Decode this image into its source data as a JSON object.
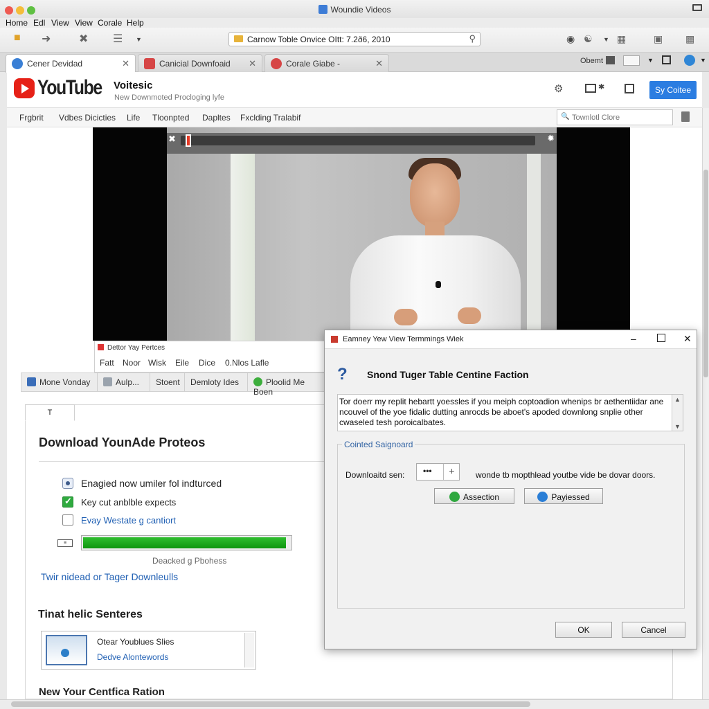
{
  "window": {
    "title": "Woundie Videos"
  },
  "menu": [
    "Home",
    "Edl",
    "View",
    "View",
    "Corale",
    "Help"
  ],
  "address": {
    "value": "Carnow Toble Onvice OItt: 7.2ð6, 2010"
  },
  "tabs": [
    {
      "label": "Cener Devidad",
      "color": "#3a7fd5"
    },
    {
      "label": "Canicial Downfoaid",
      "color": "#d64545"
    },
    {
      "label": "Corale Giabe -",
      "color": "#d64545"
    }
  ],
  "toolbar_right": {
    "label": "Obemt"
  },
  "youtube": {
    "logo_text": "YouTube",
    "site_title": "Voitesic",
    "site_subtitle": "New Downmoted Procloging lyfe",
    "signin": "Sy Coitee",
    "nav": [
      "Frgbrit",
      "Vdbes Dicicties",
      "Life",
      "Tloonpted",
      "Dapltes",
      "Fxclding Tralabif"
    ],
    "search_placeholder": "Townlotl Clore"
  },
  "video": {
    "progress": 0.01
  },
  "mini_panel": {
    "title": "Dettor Yay Pertces",
    "menu": [
      "Fatt",
      "Noor",
      "Wisk",
      "Eile",
      "Dice",
      "0.Nlos Lafle"
    ]
  },
  "button_strip": [
    "Mone Vonday",
    "Aulp...",
    "Stoent",
    "Demloty Ides",
    "Ploolid Me Boen"
  ],
  "download": {
    "tab_label": "T",
    "title": "Download YounAde Proteos",
    "options": [
      {
        "label": "Enagied now umiler fol indturced",
        "state": "radio"
      },
      {
        "label": "Key cut anblble expects",
        "state": "checked"
      },
      {
        "label": "Evay Westate g cantiort",
        "state": "unchecked"
      }
    ],
    "progress": 0.98,
    "progress_icon": "speed-icon",
    "progress_label": "Deacked g Pbohess",
    "link": "Twir nidead or Tager Downleulls",
    "related_heading": "Tinat helic Senteres",
    "related": {
      "title": "Otear Youblues Slies",
      "subtitle": "Dedve Alontewords"
    },
    "bottom_heading": "New Your Centfica Ration"
  },
  "dialog": {
    "title": "Eamney Yew View Termmings Wiek",
    "heading": "Snond Tuger Table Centine Faction",
    "message": "Tor doerr my replit hebartt yoessles if you meiph coptoadion whenips br aethentiidar ane ncouvel of the yoe fidalic dutting anrocds be aboet's apoded downlong snplie other cwaseled tesh poroicalbates.",
    "group_label": "Cointed Saignoard",
    "download_label": "Downloaitd sen:",
    "stepper_value": "•••",
    "stepper_plus": "+",
    "note": "wonde tb mopthlead youtbe vide be dovar doors.",
    "btn_assection": "Assection",
    "btn_paylessed": "Payiessed",
    "ok": "OK",
    "cancel": "Cancel"
  }
}
